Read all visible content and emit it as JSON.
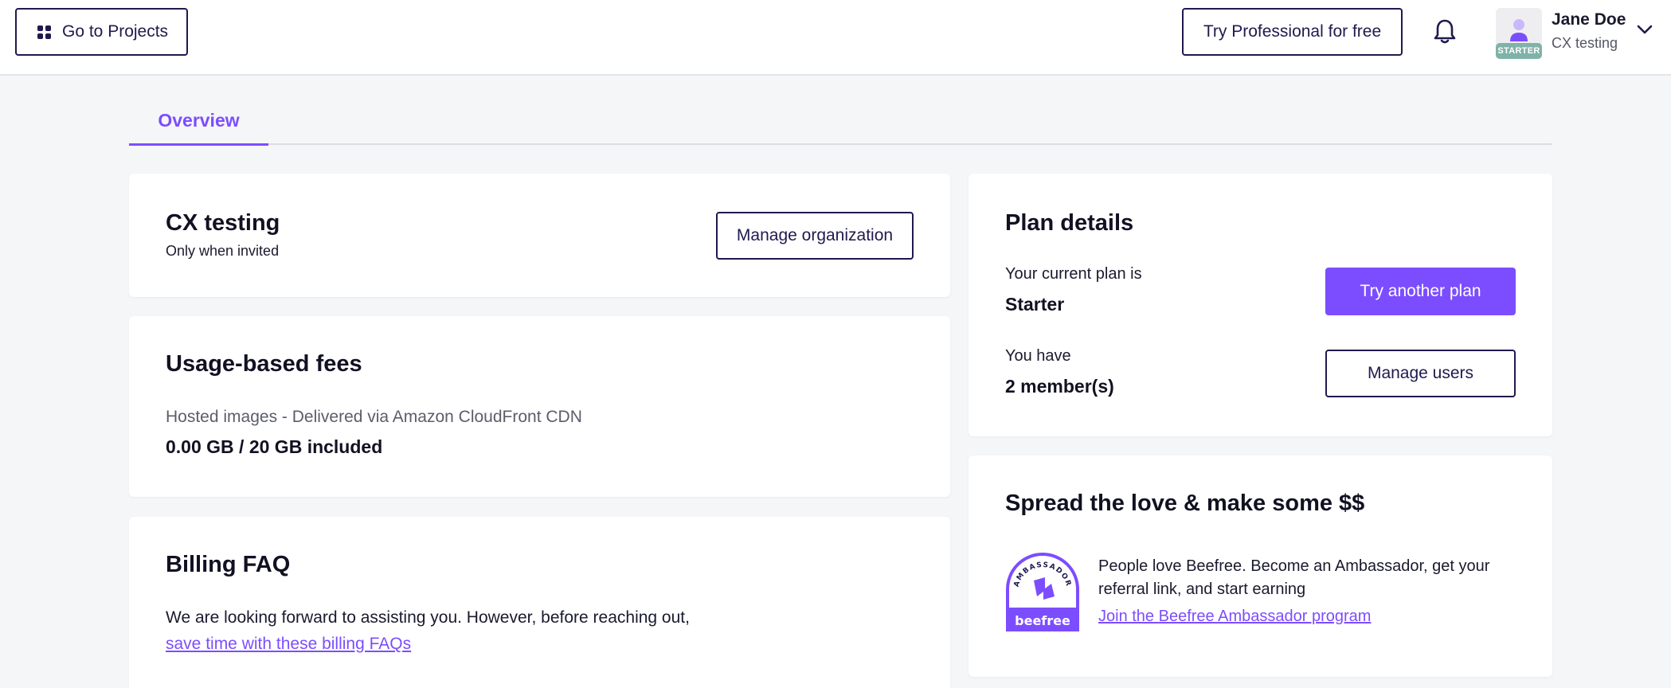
{
  "header": {
    "go_projects_label": "Go to Projects",
    "try_pro_label": "Try Professional for free",
    "user": {
      "name": "Jane Doe",
      "org": "CX testing",
      "badge": "STARTER"
    }
  },
  "tabs": [
    {
      "label": "Overview",
      "active": true
    }
  ],
  "org_card": {
    "title": "CX testing",
    "subtitle": "Only when invited",
    "manage_label": "Manage organization"
  },
  "usage_card": {
    "title": "Usage-based fees",
    "label": "Hosted images - Delivered via Amazon CloudFront CDN",
    "value": "0.00 GB / 20 GB included"
  },
  "faq_card": {
    "title": "Billing FAQ",
    "text": "We are looking forward to assisting you. However, before reaching out,",
    "link": "save time with these billing FAQs"
  },
  "plan_card": {
    "title": "Plan details",
    "plan_label": "Your current plan is",
    "plan_value": "Starter",
    "try_label": "Try another plan",
    "members_label": "You have",
    "members_value": "2 member(s)",
    "manage_users_label": "Manage users"
  },
  "ambassador_card": {
    "title": "Spread the love & make some $$",
    "text_line1": "People love Beefree. Become an Ambassador, get your",
    "text_line2": "referral link, and start earning",
    "link": "Join the Beefree Ambassador program",
    "badge_top": "AMBASSADOR",
    "badge_bottom": "beefree"
  },
  "colors": {
    "accent": "#7c4dff",
    "navy": "#1f1a4d",
    "background": "#f5f6f8"
  },
  "icons": [
    "grid-icon",
    "bell-icon",
    "avatar-icon",
    "chevron-down-icon",
    "ambassador-badge-icon"
  ]
}
